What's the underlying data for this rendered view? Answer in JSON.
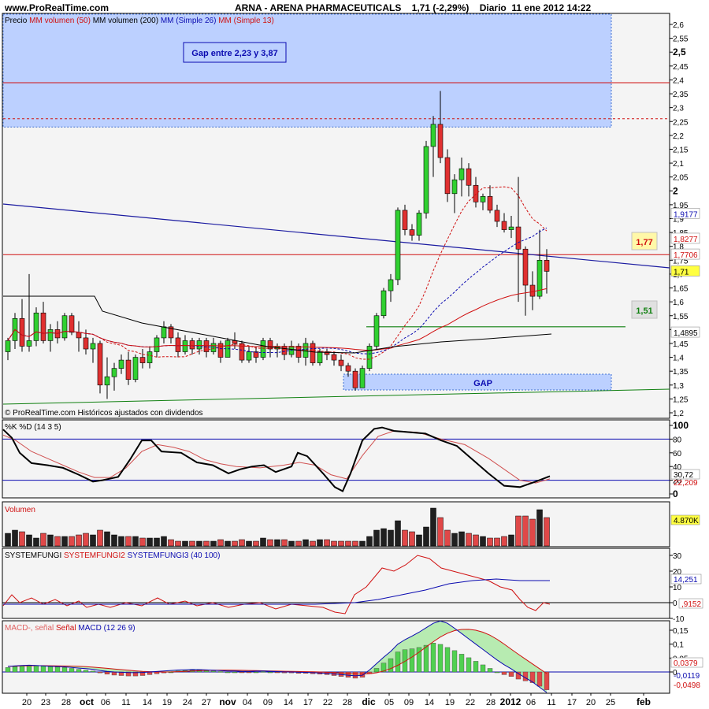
{
  "header": {
    "site": "www.ProRealTime.com",
    "ticker": "ARNA - ARENA PHARMACEUTICALS",
    "quote": "1,71 (-2,29%)",
    "period": "Diario",
    "datetime": "11 ene 2012 14:22"
  },
  "price_panel": {
    "legend": [
      "Precio",
      "MM volumen (50)",
      "MM volumen (200)",
      "MM (Simple 26)",
      "MM (Simple 13)"
    ],
    "legend_colors": [
      "#000000",
      "#d01010",
      "#000000",
      "#0a0ab0",
      "#d01010"
    ],
    "footer": "© ProRealTime.com  Históricos ajustados con dividendos",
    "gap_note": "Gap entre 2,23 y 3,87",
    "gap_label": "GAP",
    "level_high_label": "1,77",
    "level_low_label": "1,51",
    "y_ticks": [
      "2,6",
      "2,55",
      "2,5",
      "2,45",
      "2,4",
      "2,35",
      "2,3",
      "2,25",
      "2,2",
      "2,15",
      "2,1",
      "2,05",
      "2",
      "1,95",
      "1,9",
      "1,85",
      "1,8",
      "1,75",
      "1,7",
      "1,65",
      "1,6",
      "1,55",
      "1,5",
      "1,45",
      "1,4",
      "1,35",
      "1,3",
      "1,25",
      "1,2"
    ],
    "right_labels": [
      "1,9177",
      "1,8277",
      "1,7706",
      "1,71",
      "1,4895"
    ]
  },
  "stoch_panel": {
    "legend": "%K %D (14 3 5)",
    "y_ticks": [
      "100",
      "80",
      "60",
      "40",
      "20",
      "0"
    ],
    "right_labels": [
      "30,72",
      "22,209"
    ]
  },
  "volume_panel": {
    "legend": "Volumen",
    "right_label": "4.870K"
  },
  "fungi_panel": {
    "legend": [
      "SYSTEMFUNGI",
      "SYSTEMFUNGI2",
      "SYSTEMFUNGI3 (40 100)"
    ],
    "legend_colors": [
      "#000000",
      "#d01010",
      "#0a0ab0"
    ],
    "y_ticks": [
      "30",
      "20",
      "10",
      "0",
      "-10"
    ],
    "right_labels": [
      "14,251",
      ",9152"
    ]
  },
  "macd_panel": {
    "legend": [
      "MACD-, señal",
      "Señal",
      "MACD (12 26 9)"
    ],
    "legend_colors": [
      "#e06060",
      "#d01010",
      "#0a0ab0"
    ],
    "y_ticks": [
      "0,15",
      "0,1",
      "0,05",
      "0"
    ],
    "right_labels": [
      "0,0379",
      "-0,0119",
      "-0,0498"
    ]
  },
  "x_axis": {
    "labels": [
      "20",
      "23",
      "28",
      "oct",
      "06",
      "11",
      "14",
      "19",
      "24",
      "27",
      "nov",
      "04",
      "09",
      "14",
      "17",
      "22",
      "28",
      "dic",
      "05",
      "09",
      "14",
      "19",
      "22",
      "28",
      "2012",
      "06",
      "11",
      "17",
      "20",
      "25",
      "feb"
    ],
    "bold": [
      "oct",
      "nov",
      "dic",
      "2012",
      "feb"
    ]
  },
  "chart_data": {
    "type": "candlestick",
    "ylim": [
      1.2,
      2.62
    ],
    "candles": [
      [
        1.42,
        1.47,
        1.39,
        1.46
      ],
      [
        1.46,
        1.56,
        1.43,
        1.54
      ],
      [
        1.54,
        1.61,
        1.42,
        1.44
      ],
      [
        1.44,
        1.7,
        1.42,
        1.46
      ],
      [
        1.46,
        1.58,
        1.44,
        1.56
      ],
      [
        1.56,
        1.6,
        1.45,
        1.46
      ],
      [
        1.46,
        1.52,
        1.42,
        1.5
      ],
      [
        1.5,
        1.53,
        1.45,
        1.47
      ],
      [
        1.47,
        1.56,
        1.46,
        1.55
      ],
      [
        1.55,
        1.56,
        1.48,
        1.49
      ],
      [
        1.49,
        1.53,
        1.42,
        1.47
      ],
      [
        1.47,
        1.5,
        1.41,
        1.43
      ],
      [
        1.43,
        1.47,
        1.38,
        1.45
      ],
      [
        1.45,
        1.46,
        1.27,
        1.3
      ],
      [
        1.3,
        1.4,
        1.25,
        1.33
      ],
      [
        1.33,
        1.38,
        1.28,
        1.36
      ],
      [
        1.36,
        1.41,
        1.34,
        1.39
      ],
      [
        1.39,
        1.42,
        1.3,
        1.32
      ],
      [
        1.32,
        1.41,
        1.31,
        1.4
      ],
      [
        1.4,
        1.43,
        1.36,
        1.38
      ],
      [
        1.38,
        1.44,
        1.36,
        1.42
      ],
      [
        1.42,
        1.48,
        1.4,
        1.47
      ],
      [
        1.47,
        1.53,
        1.45,
        1.51
      ],
      [
        1.51,
        1.52,
        1.45,
        1.47
      ],
      [
        1.47,
        1.49,
        1.4,
        1.42
      ],
      [
        1.42,
        1.48,
        1.41,
        1.46
      ],
      [
        1.46,
        1.47,
        1.41,
        1.43
      ],
      [
        1.43,
        1.47,
        1.41,
        1.46
      ],
      [
        1.46,
        1.47,
        1.4,
        1.42
      ],
      [
        1.42,
        1.47,
        1.41,
        1.45
      ],
      [
        1.45,
        1.46,
        1.38,
        1.4
      ],
      [
        1.4,
        1.47,
        1.4,
        1.46
      ],
      [
        1.46,
        1.49,
        1.43,
        1.45
      ],
      [
        1.45,
        1.46,
        1.38,
        1.39
      ],
      [
        1.39,
        1.44,
        1.38,
        1.42
      ],
      [
        1.42,
        1.44,
        1.38,
        1.4
      ],
      [
        1.4,
        1.47,
        1.39,
        1.46
      ],
      [
        1.46,
        1.47,
        1.4,
        1.43
      ],
      [
        1.43,
        1.45,
        1.4,
        1.44
      ],
      [
        1.44,
        1.45,
        1.39,
        1.41
      ],
      [
        1.41,
        1.46,
        1.4,
        1.44
      ],
      [
        1.44,
        1.45,
        1.38,
        1.4
      ],
      [
        1.4,
        1.47,
        1.37,
        1.45
      ],
      [
        1.45,
        1.46,
        1.37,
        1.38
      ],
      [
        1.38,
        1.43,
        1.37,
        1.42
      ],
      [
        1.42,
        1.43,
        1.39,
        1.41
      ],
      [
        1.41,
        1.42,
        1.37,
        1.39
      ],
      [
        1.39,
        1.41,
        1.35,
        1.37
      ],
      [
        1.37,
        1.38,
        1.33,
        1.35
      ],
      [
        1.35,
        1.36,
        1.28,
        1.29
      ],
      [
        1.29,
        1.37,
        1.29,
        1.36
      ],
      [
        1.36,
        1.45,
        1.35,
        1.44
      ],
      [
        1.44,
        1.56,
        1.43,
        1.55
      ],
      [
        1.55,
        1.65,
        1.54,
        1.64
      ],
      [
        1.64,
        1.7,
        1.6,
        1.68
      ],
      [
        1.68,
        1.94,
        1.66,
        1.93
      ],
      [
        1.93,
        1.95,
        1.84,
        1.86
      ],
      [
        1.86,
        1.88,
        1.82,
        1.84
      ],
      [
        1.84,
        1.93,
        1.82,
        1.92
      ],
      [
        1.92,
        2.18,
        1.9,
        2.16
      ],
      [
        2.16,
        2.27,
        2.05,
        2.24
      ],
      [
        2.24,
        2.36,
        2.1,
        2.12
      ],
      [
        2.12,
        2.15,
        1.96,
        1.99
      ],
      [
        1.99,
        2.06,
        1.92,
        2.04
      ],
      [
        2.04,
        2.12,
        1.98,
        2.08
      ],
      [
        2.08,
        2.1,
        1.98,
        2.02
      ],
      [
        2.02,
        2.05,
        1.94,
        1.96
      ],
      [
        1.96,
        1.99,
        1.93,
        1.98
      ],
      [
        1.98,
        2.02,
        1.92,
        1.93
      ],
      [
        1.93,
        1.95,
        1.87,
        1.89
      ],
      [
        1.89,
        1.92,
        1.85,
        1.86
      ],
      [
        1.86,
        1.91,
        1.83,
        1.87
      ],
      [
        1.87,
        2.05,
        1.6,
        1.79
      ],
      [
        1.79,
        1.8,
        1.55,
        1.66
      ],
      [
        1.66,
        1.71,
        1.57,
        1.62
      ],
      [
        1.62,
        1.86,
        1.61,
        1.75
      ],
      [
        1.75,
        1.79,
        1.63,
        1.71
      ]
    ],
    "levels": {
      "gap_zone": [
        2.23,
        2.62
      ],
      "resistance_red": 2.39,
      "dashed_red": 2.26,
      "level_177": 1.77,
      "support_green": 1.51,
      "gap_low": [
        1.29,
        1.35
      ]
    },
    "stoch_last": [
      30.72,
      22.209
    ],
    "volume_last": "4.870K",
    "macd_last": [
      0.0379,
      -0.0119,
      -0.0498
    ]
  }
}
